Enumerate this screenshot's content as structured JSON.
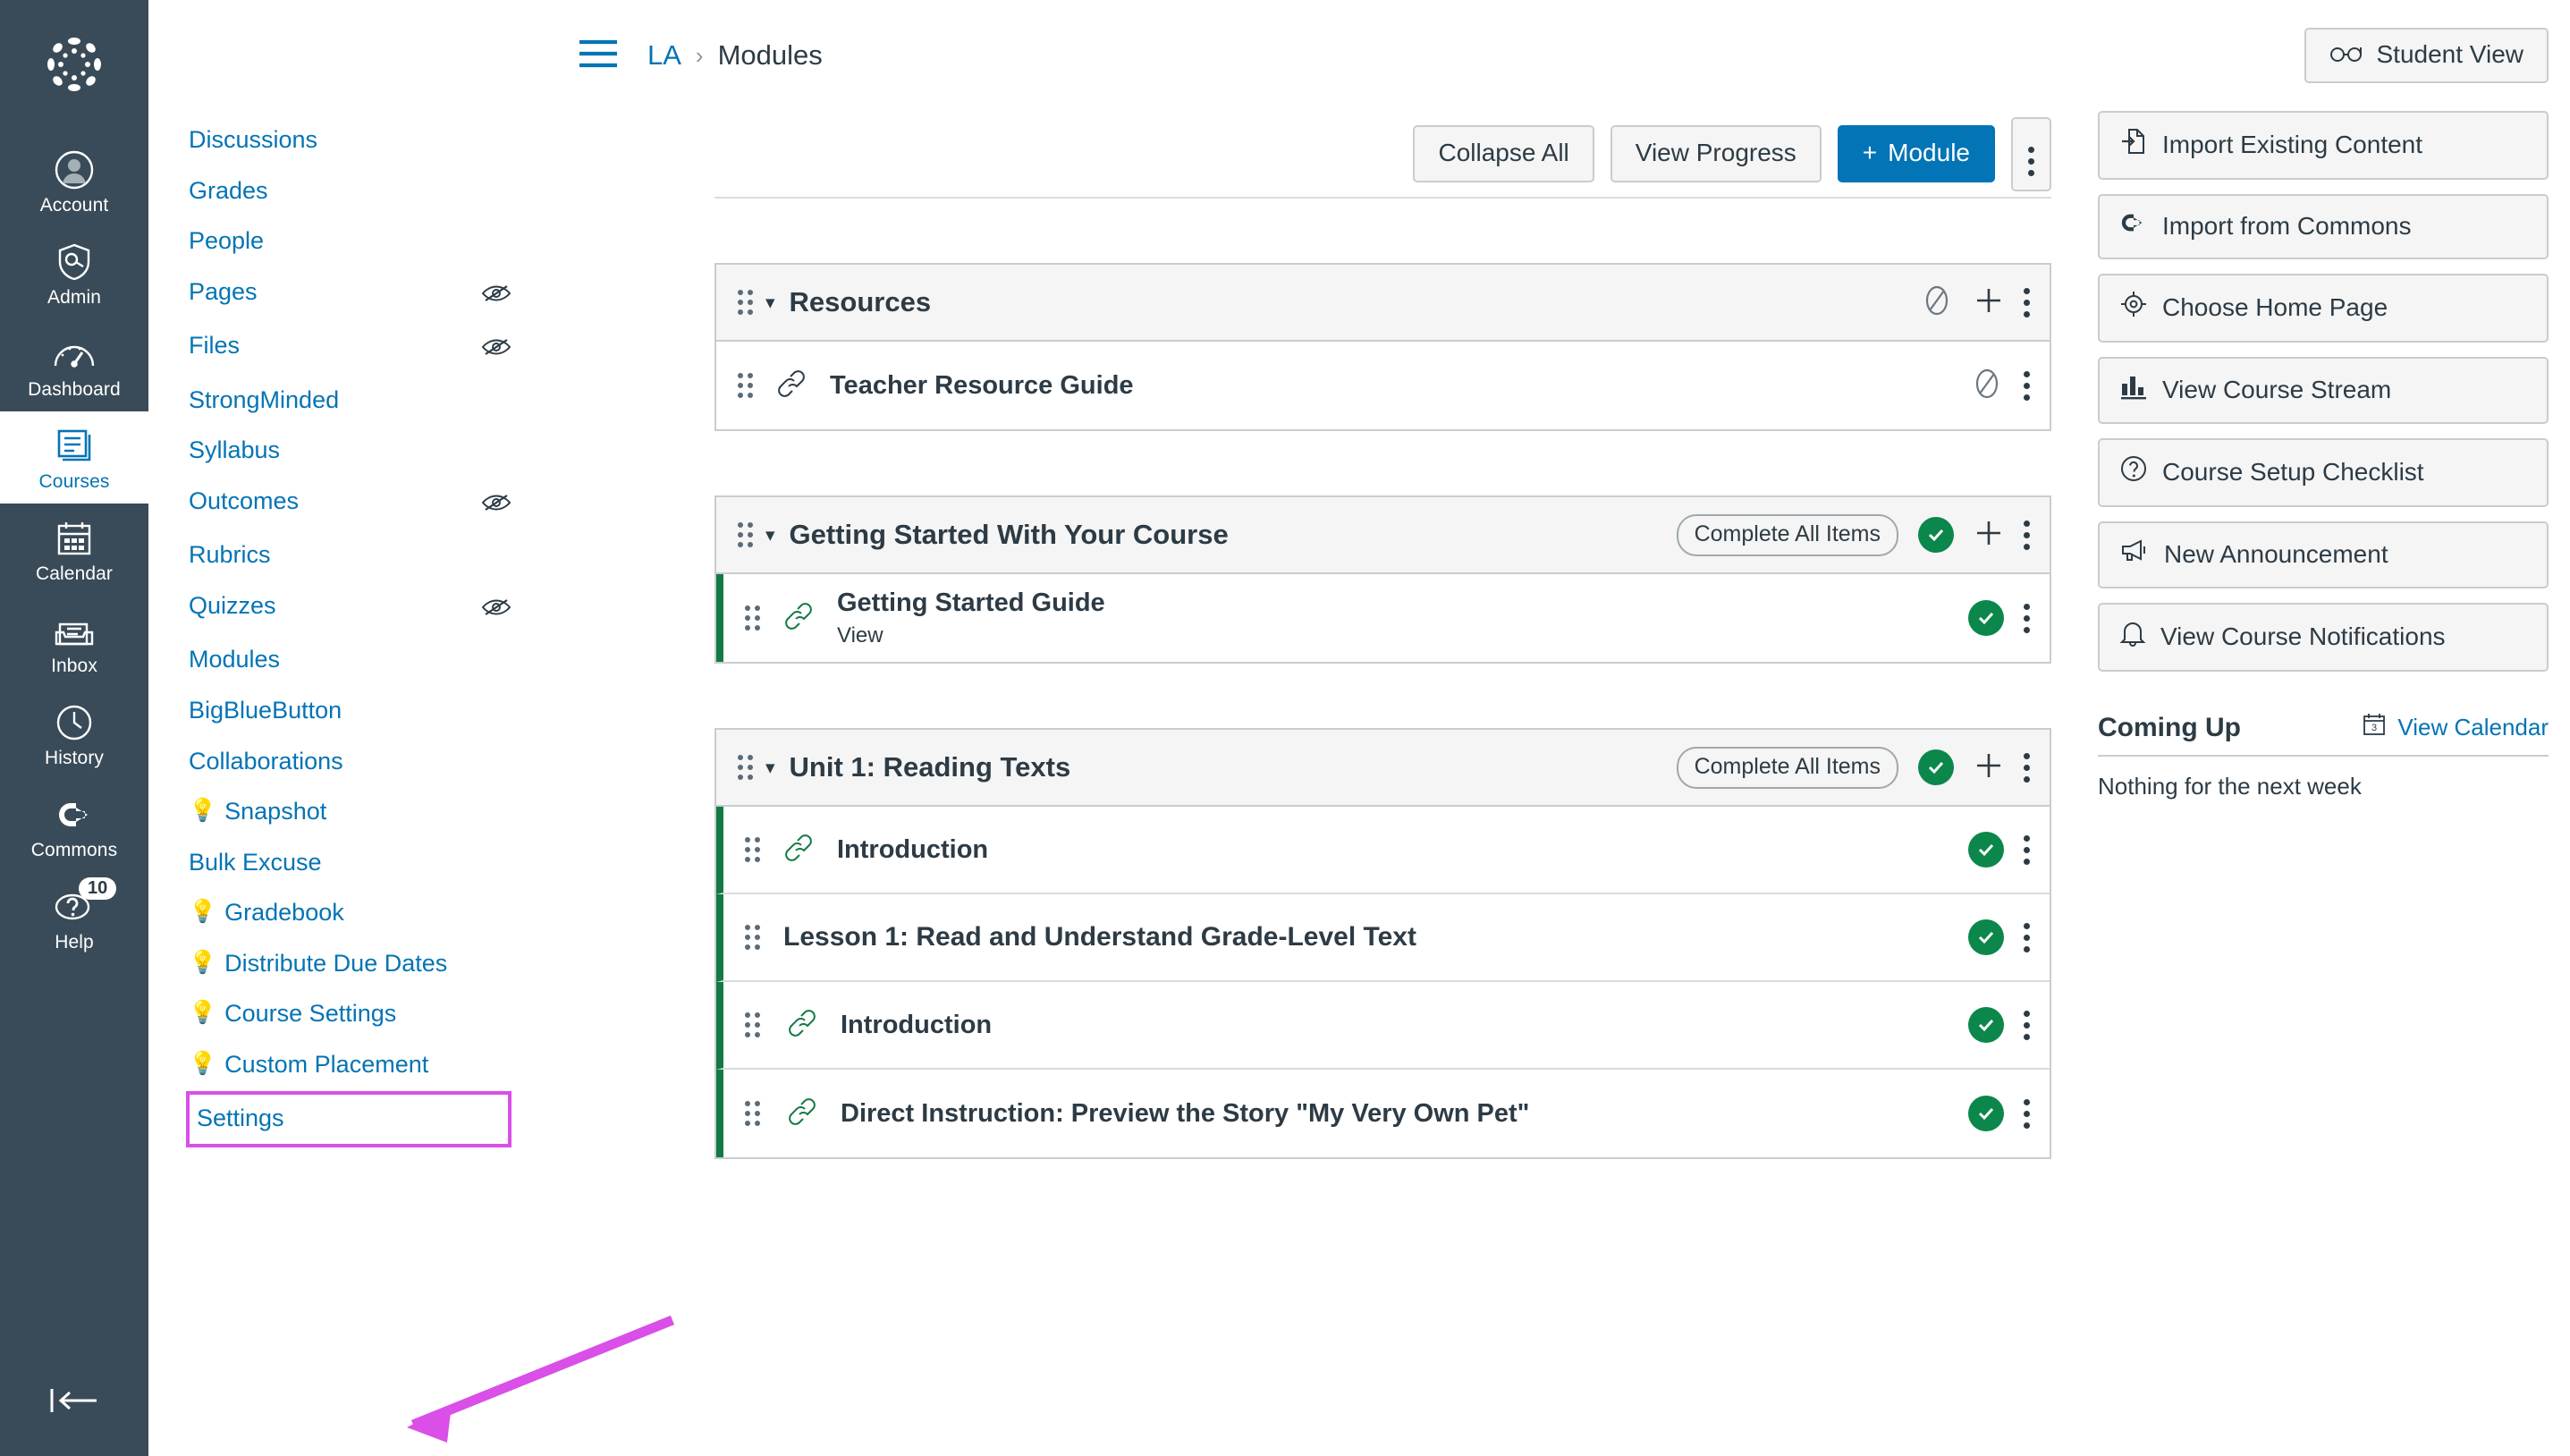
{
  "colors": {
    "brand_blue": "#0374B5",
    "dark_nav": "#394B58",
    "published_green": "#0B874B",
    "annotation_magenta": "#D94FE8",
    "text_dark": "#2D3B45",
    "border_grey": "#C7CDD1"
  },
  "global_nav": {
    "logo_name": "canvas-logo",
    "items": [
      {
        "label": "Account",
        "icon": "user-avatar-icon",
        "active": false
      },
      {
        "label": "Admin",
        "icon": "shield-key-icon",
        "active": false
      },
      {
        "label": "Dashboard",
        "icon": "gauge-icon",
        "active": false
      },
      {
        "label": "Courses",
        "icon": "book-icon",
        "active": true
      },
      {
        "label": "Calendar",
        "icon": "calendar-icon",
        "active": false
      },
      {
        "label": "Inbox",
        "icon": "inbox-tray-icon",
        "active": false
      },
      {
        "label": "History",
        "icon": "clock-icon",
        "active": false
      },
      {
        "label": "Commons",
        "icon": "arrow-out-icon",
        "active": false
      },
      {
        "label": "Help",
        "icon": "question-bubble-icon",
        "active": false,
        "badge": "10"
      }
    ],
    "collapse_icon": "collapse-left-icon"
  },
  "course_nav": {
    "items": [
      {
        "label": "Discussions",
        "hidden": false,
        "bulb": false
      },
      {
        "label": "Grades",
        "hidden": false,
        "bulb": false
      },
      {
        "label": "People",
        "hidden": false,
        "bulb": false
      },
      {
        "label": "Pages",
        "hidden": true,
        "bulb": false
      },
      {
        "label": "Files",
        "hidden": true,
        "bulb": false
      },
      {
        "label": "StrongMinded",
        "hidden": false,
        "bulb": false
      },
      {
        "label": "Syllabus",
        "hidden": false,
        "bulb": false
      },
      {
        "label": "Outcomes",
        "hidden": true,
        "bulb": false
      },
      {
        "label": "Rubrics",
        "hidden": false,
        "bulb": false
      },
      {
        "label": "Quizzes",
        "hidden": true,
        "bulb": false
      },
      {
        "label": "Modules",
        "hidden": false,
        "bulb": false
      },
      {
        "label": "BigBlueButton",
        "hidden": false,
        "bulb": false
      },
      {
        "label": "Collaborations",
        "hidden": false,
        "bulb": false
      },
      {
        "label": "Snapshot",
        "hidden": false,
        "bulb": true
      },
      {
        "label": "Bulk Excuse",
        "hidden": false,
        "bulb": false
      },
      {
        "label": "Gradebook",
        "hidden": false,
        "bulb": true
      },
      {
        "label": "Distribute Due Dates",
        "hidden": false,
        "bulb": true
      },
      {
        "label": "Course Settings",
        "hidden": false,
        "bulb": true
      },
      {
        "label": "Custom Placement",
        "hidden": false,
        "bulb": true
      },
      {
        "label": "Settings",
        "hidden": false,
        "bulb": false,
        "highlighted": true
      }
    ],
    "bulb_glyph": "💡",
    "hidden_icon": "eye-slash-icon"
  },
  "header": {
    "menu_icon": "hamburger-menu-icon",
    "breadcrumb_course": "LA",
    "breadcrumb_sep": "›",
    "breadcrumb_page": "Modules",
    "student_view_label": "Student View",
    "student_view_icon": "eyeglasses-icon"
  },
  "toolbar": {
    "collapse_all": "Collapse All",
    "view_progress": "View Progress",
    "add_module": "Module",
    "add_module_plus": "+",
    "kebab_icon": "more-options-icon"
  },
  "modules": [
    {
      "title": "Resources",
      "published": false,
      "pill": null,
      "status_icon": "unpublished-circle-icon",
      "items": [
        {
          "title": "Teacher Resource Guide",
          "subtitle": null,
          "type": "link",
          "icon": "link-icon",
          "published": false,
          "indent": 0
        }
      ]
    },
    {
      "title": "Getting Started With Your Course",
      "published": true,
      "pill": "Complete All Items",
      "status_icon": "published-check-icon",
      "items": [
        {
          "title": "Getting Started Guide",
          "subtitle": "View",
          "type": "link",
          "icon": "link-icon",
          "published": true,
          "indent": 0
        }
      ]
    },
    {
      "title": "Unit 1: Reading Texts",
      "published": true,
      "pill": "Complete All Items",
      "status_icon": "published-check-icon",
      "items": [
        {
          "title": "Introduction",
          "subtitle": null,
          "type": "link",
          "icon": "link-icon",
          "published": true,
          "indent": 0
        },
        {
          "title": "Lesson 1: Read and Understand Grade-Level Text",
          "subtitle": null,
          "type": "text-header",
          "icon": null,
          "published": true,
          "indent": 0
        },
        {
          "title": "Introduction",
          "subtitle": null,
          "type": "link",
          "icon": "link-icon",
          "published": true,
          "indent": 1
        },
        {
          "title": "Direct Instruction: Preview the Story \"My Very Own Pet\"",
          "subtitle": null,
          "type": "link",
          "icon": "link-icon",
          "published": true,
          "indent": 1
        }
      ]
    }
  ],
  "sidebar": {
    "buttons": [
      {
        "label": "Import Existing Content",
        "icon": "import-arrow-icon"
      },
      {
        "label": "Import from Commons",
        "icon": "commons-arrow-icon"
      },
      {
        "label": "Choose Home Page",
        "icon": "target-icon"
      },
      {
        "label": "View Course Stream",
        "icon": "bar-chart-icon"
      },
      {
        "label": "Course Setup Checklist",
        "icon": "question-circle-icon"
      },
      {
        "label": "New Announcement",
        "icon": "megaphone-icon"
      },
      {
        "label": "View Course Notifications",
        "icon": "bell-icon"
      }
    ],
    "coming_up_title": "Coming Up",
    "view_calendar_label": "View Calendar",
    "calendar_icon_day": "3",
    "coming_up_empty": "Nothing for the next week"
  },
  "annotation": {
    "arrow_icon": "magenta-pointer-arrow",
    "highlight_target": "Settings"
  }
}
